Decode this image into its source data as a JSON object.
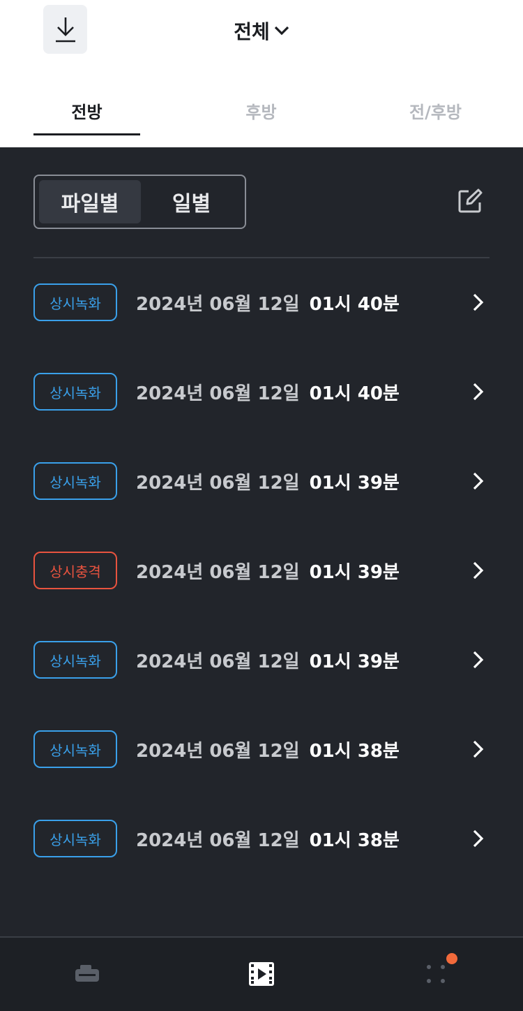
{
  "header": {
    "title": "전체",
    "download_icon": "download-icon",
    "dropdown_icon": "chevron-down-icon"
  },
  "tabs": [
    {
      "label": "전방",
      "active": true
    },
    {
      "label": "후방",
      "active": false
    },
    {
      "label": "전/후방",
      "active": false
    }
  ],
  "segment": {
    "options": [
      {
        "label": "파일별",
        "active": true
      },
      {
        "label": "일별",
        "active": false
      }
    ]
  },
  "edit_icon": "edit-icon",
  "recordings": [
    {
      "badge": "상시녹화",
      "type": "normal",
      "date": "2024년 06월 12일",
      "time": "01시 40분"
    },
    {
      "badge": "상시녹화",
      "type": "normal",
      "date": "2024년 06월 12일",
      "time": "01시 40분"
    },
    {
      "badge": "상시녹화",
      "type": "normal",
      "date": "2024년 06월 12일",
      "time": "01시 39분"
    },
    {
      "badge": "상시충격",
      "type": "impact",
      "date": "2024년 06월 12일",
      "time": "01시 39분"
    },
    {
      "badge": "상시녹화",
      "type": "normal",
      "date": "2024년 06월 12일",
      "time": "01시 39분"
    },
    {
      "badge": "상시녹화",
      "type": "normal",
      "date": "2024년 06월 12일",
      "time": "01시 38분"
    },
    {
      "badge": "상시녹화",
      "type": "normal",
      "date": "2024년 06월 12일",
      "time": "01시 38분"
    }
  ],
  "bottom_nav": [
    {
      "icon": "dashcam-icon",
      "active": false
    },
    {
      "icon": "video-icon",
      "active": true
    },
    {
      "icon": "more-dots-icon",
      "active": false,
      "notification": true
    }
  ],
  "colors": {
    "normal_badge": "#3aa0ea",
    "impact_badge": "#e8533f",
    "notification": "#f26a3b",
    "background": "#22252b"
  }
}
